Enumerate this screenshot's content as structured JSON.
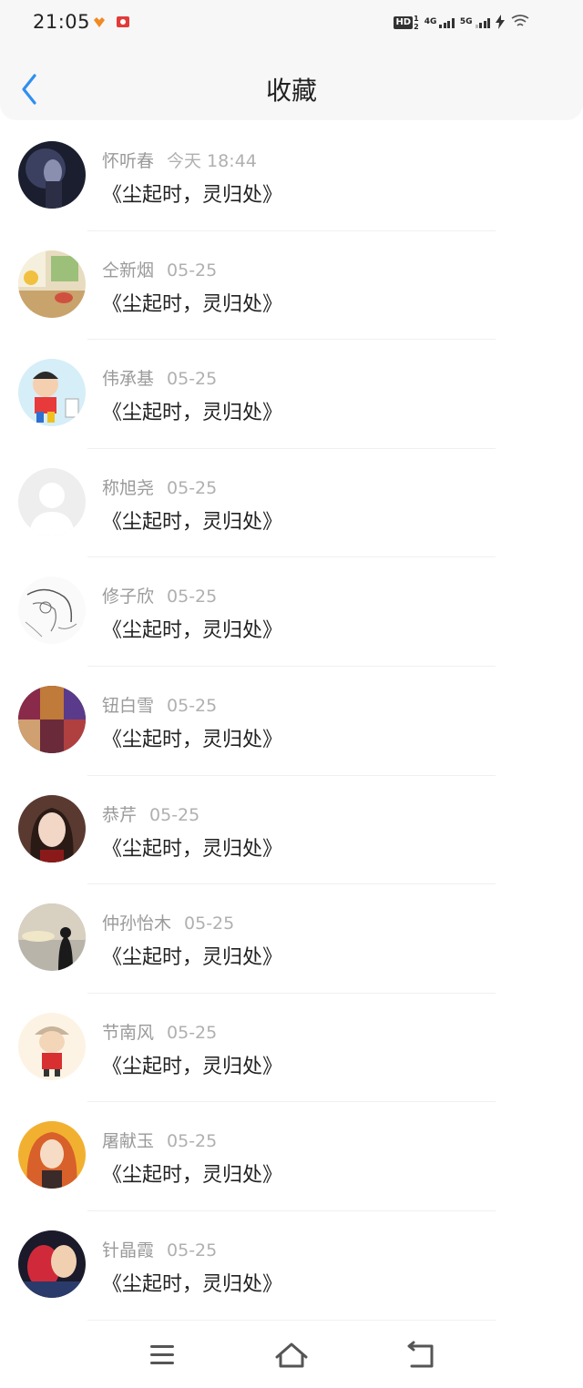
{
  "status_bar": {
    "time": "21:05",
    "app_icons": [
      "heart-app-icon",
      "gift-app-icon"
    ],
    "hd_label": "HD",
    "hd_sub": [
      "1",
      "2"
    ],
    "network_1": "4G",
    "network_2": "5G",
    "icons": [
      "signal-icon",
      "signal-icon",
      "charging-icon",
      "wifi-icon"
    ]
  },
  "header": {
    "title": "收藏",
    "back_icon": "back-chevron-icon"
  },
  "colors": {
    "accent": "#2f8ff0",
    "text_primary": "#222222",
    "text_secondary": "#9a9a9a"
  },
  "favorites": [
    {
      "name": "怀听春",
      "date": "今天 18:44",
      "title": "《尘起时，灵归处》",
      "avatar": "dark-figure-avatar"
    },
    {
      "name": "仝新烟",
      "date": "05-25",
      "title": "《尘起时，灵归处》",
      "avatar": "window-plants-avatar"
    },
    {
      "name": "伟承基",
      "date": "05-25",
      "title": "《尘起时，灵归处》",
      "avatar": "cartoon-boy-avatar"
    },
    {
      "name": "称旭尧",
      "date": "05-25",
      "title": "《尘起时，灵归处》",
      "avatar": "default-user-avatar"
    },
    {
      "name": "修子欣",
      "date": "05-25",
      "title": "《尘起时，灵归处》",
      "avatar": "manga-sketch-avatar"
    },
    {
      "name": "钮白雪",
      "date": "05-25",
      "title": "《尘起时，灵归处》",
      "avatar": "collage-avatar"
    },
    {
      "name": "恭芹",
      "date": "05-25",
      "title": "《尘起时，灵归处》",
      "avatar": "illustrated-girl-avatar"
    },
    {
      "name": "仲孙怡木",
      "date": "05-25",
      "title": "《尘起时，灵归处》",
      "avatar": "sunset-silhouette-avatar"
    },
    {
      "name": "节南风",
      "date": "05-25",
      "title": "《尘起时，灵归处》",
      "avatar": "cartoon-character-avatar"
    },
    {
      "name": "屠献玉",
      "date": "05-25",
      "title": "《尘起时，灵归处》",
      "avatar": "anime-redhead-avatar"
    },
    {
      "name": "针晶霞",
      "date": "05-25",
      "title": "《尘起时，灵归处》",
      "avatar": "couple-photo-avatar"
    }
  ],
  "nav_bar": {
    "icons": [
      "menu-icon",
      "home-icon",
      "back-icon"
    ]
  }
}
